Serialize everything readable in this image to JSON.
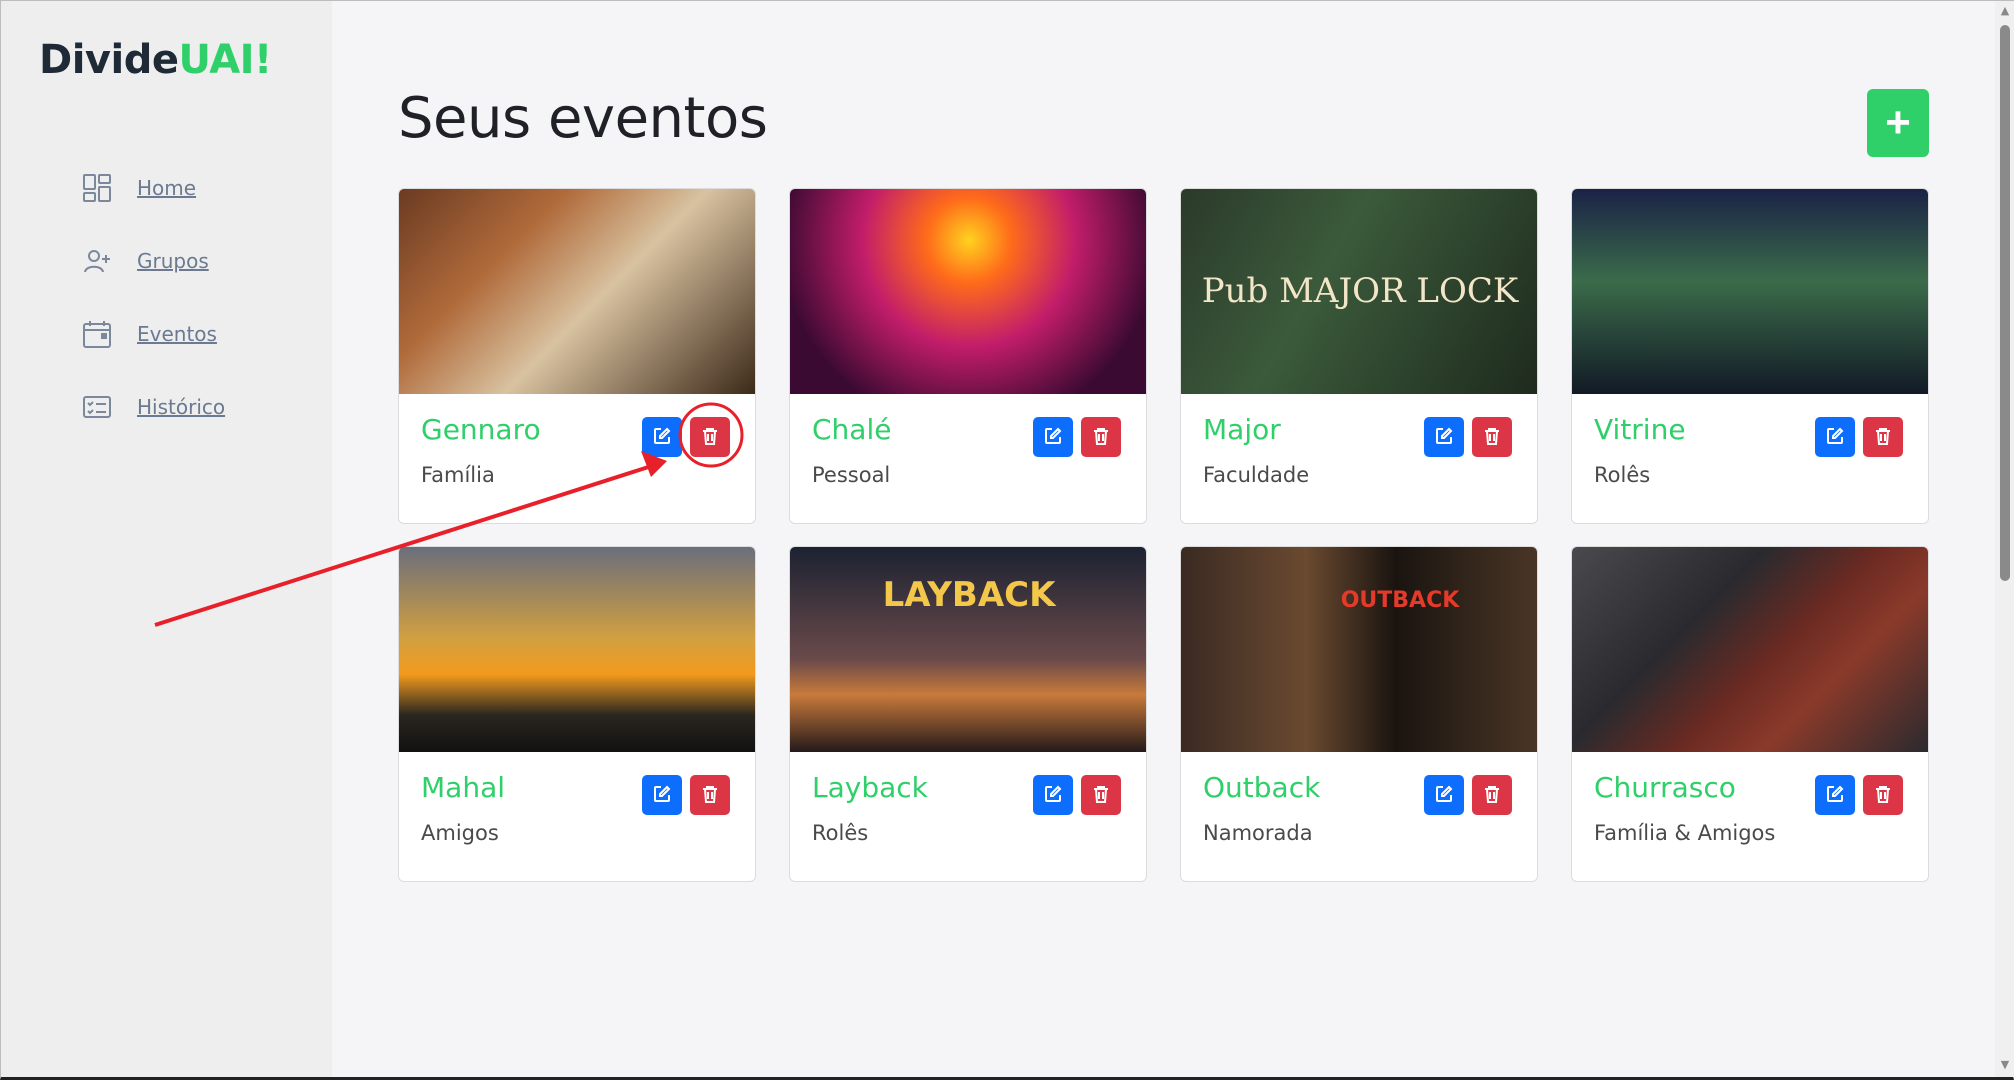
{
  "app": {
    "brand_part1": "Divide",
    "brand_part2": "UAI!"
  },
  "sidebar": {
    "items": [
      {
        "label": "Home",
        "icon": "dashboard-icon"
      },
      {
        "label": "Grupos",
        "icon": "add-user-icon"
      },
      {
        "label": "Eventos",
        "icon": "calendar-icon"
      },
      {
        "label": "Histórico",
        "icon": "list-icon"
      }
    ]
  },
  "main": {
    "title": "Seus eventos",
    "add_button": "+",
    "events": [
      {
        "name": "Gennaro",
        "group": "Família"
      },
      {
        "name": "Chalé",
        "group": "Pessoal"
      },
      {
        "name": "Major",
        "group": "Faculdade",
        "image_text": "Pub MAJOR LOCK"
      },
      {
        "name": "Vitrine",
        "group": "Rolês"
      },
      {
        "name": "Mahal",
        "group": "Amigos"
      },
      {
        "name": "Layback",
        "group": "Rolês",
        "image_text": "LAYBACK"
      },
      {
        "name": "Outback",
        "group": "Namorada",
        "image_text": "OUTBACK"
      },
      {
        "name": "Churrasco",
        "group": "Família & Amigos"
      }
    ]
  },
  "colors": {
    "accent": "#2fcf6a",
    "edit": "#0d6efd",
    "delete": "#dc3545",
    "annotation": "#e8202a"
  }
}
